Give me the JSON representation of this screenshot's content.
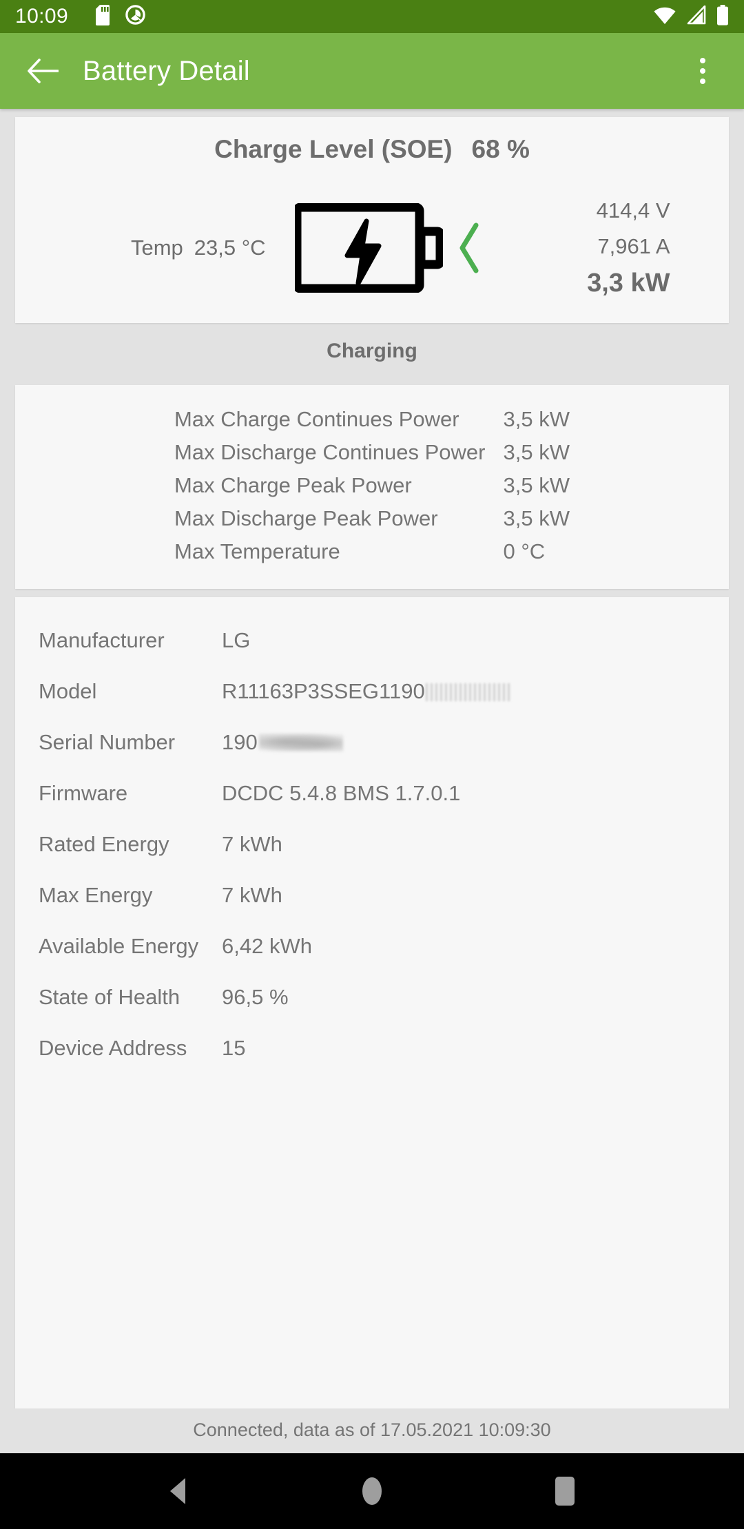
{
  "status_bar": {
    "time": "10:09",
    "icons": [
      "sd-card-icon",
      "android-q-icon",
      "wifi-icon",
      "cellular-signal-icon",
      "battery-icon"
    ]
  },
  "app_bar": {
    "back_label": "back-arrow",
    "title": "Battery Detail",
    "overflow_label": "more-options"
  },
  "soe_card": {
    "title": "Charge Level (SOE)",
    "percent": "68 %",
    "temp_label": "Temp",
    "temp_value": "23,5 °C",
    "voltage": "414,4 V",
    "current": "7,961 A",
    "power": "3,3 kW",
    "flow_direction_icon": "chevron-left-icon",
    "flow_color": "#4caf50",
    "battery_icon": "battery-charging-icon"
  },
  "charging_section": {
    "label": "Charging",
    "rows": [
      {
        "key": "Max Charge Continues Power",
        "value": "3,5 kW"
      },
      {
        "key": "Max Discharge Continues Power",
        "value": "3,5 kW"
      },
      {
        "key": "Max Charge Peak Power",
        "value": "3,5 kW"
      },
      {
        "key": "Max Discharge Peak Power",
        "value": "3,5 kW"
      },
      {
        "key": "Max Temperature",
        "value": "0 °C"
      }
    ]
  },
  "device_info": {
    "rows": [
      {
        "key": "Manufacturer",
        "value": "LG"
      },
      {
        "key": "Model",
        "value": "R11163P3SSEG1190"
      },
      {
        "key": "Serial Number",
        "value": "190"
      },
      {
        "key": "Firmware",
        "value": "DCDC 5.4.8 BMS 1.7.0.1"
      },
      {
        "key": "Rated Energy",
        "value": "7 kWh"
      },
      {
        "key": "Max Energy",
        "value": "7 kWh"
      },
      {
        "key": "Available Energy",
        "value": "6,42 kWh"
      },
      {
        "key": "State of Health",
        "value": "96,5 %"
      },
      {
        "key": "Device Address",
        "value": "15"
      }
    ]
  },
  "footer": {
    "status": "Connected, data as of 17.05.2021 10:09:30"
  },
  "nav_bar": {
    "back": "nav-back-icon",
    "home": "nav-home-icon",
    "recents": "nav-recents-icon"
  },
  "theme": {
    "status_bar_color": "#4a8013",
    "app_bar_color": "#7ab648",
    "page_background": "#e2e2e2",
    "card_background": "#f7f7f7",
    "text_color": "#757575"
  }
}
